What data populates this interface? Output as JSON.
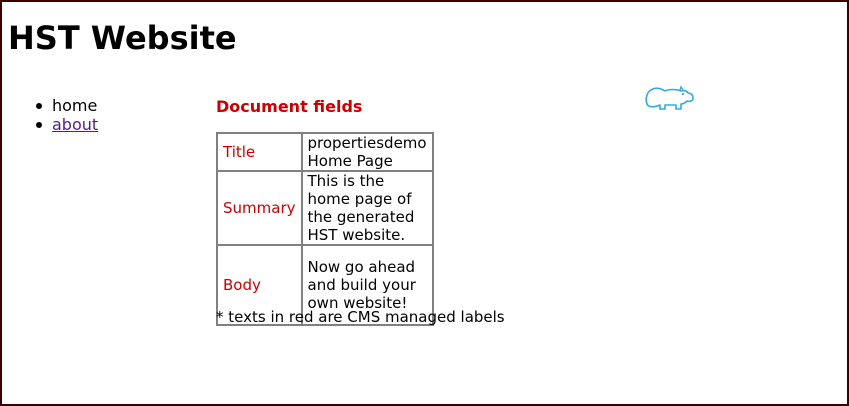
{
  "site": {
    "title": "HST Website"
  },
  "nav": {
    "items": [
      {
        "label": "home",
        "current": true
      },
      {
        "label": "about",
        "current": false
      }
    ]
  },
  "logo": {
    "icon": "hippo-logo-icon",
    "color": "#33aadd"
  },
  "content": {
    "heading": "Document fields",
    "fields": [
      {
        "label": "Title",
        "value": "propertiesdemo Home Page"
      },
      {
        "label": "Summary",
        "value": "This is the home page of the generated HST website."
      },
      {
        "label": "Body",
        "value": "Now go ahead and build your own website!"
      }
    ],
    "footnote": "* texts in red are CMS managed labels"
  },
  "colors": {
    "label_red": "#cc0000",
    "link_visited": "#551a8b",
    "frame_border": "#3a0000",
    "table_border": "#808080"
  }
}
